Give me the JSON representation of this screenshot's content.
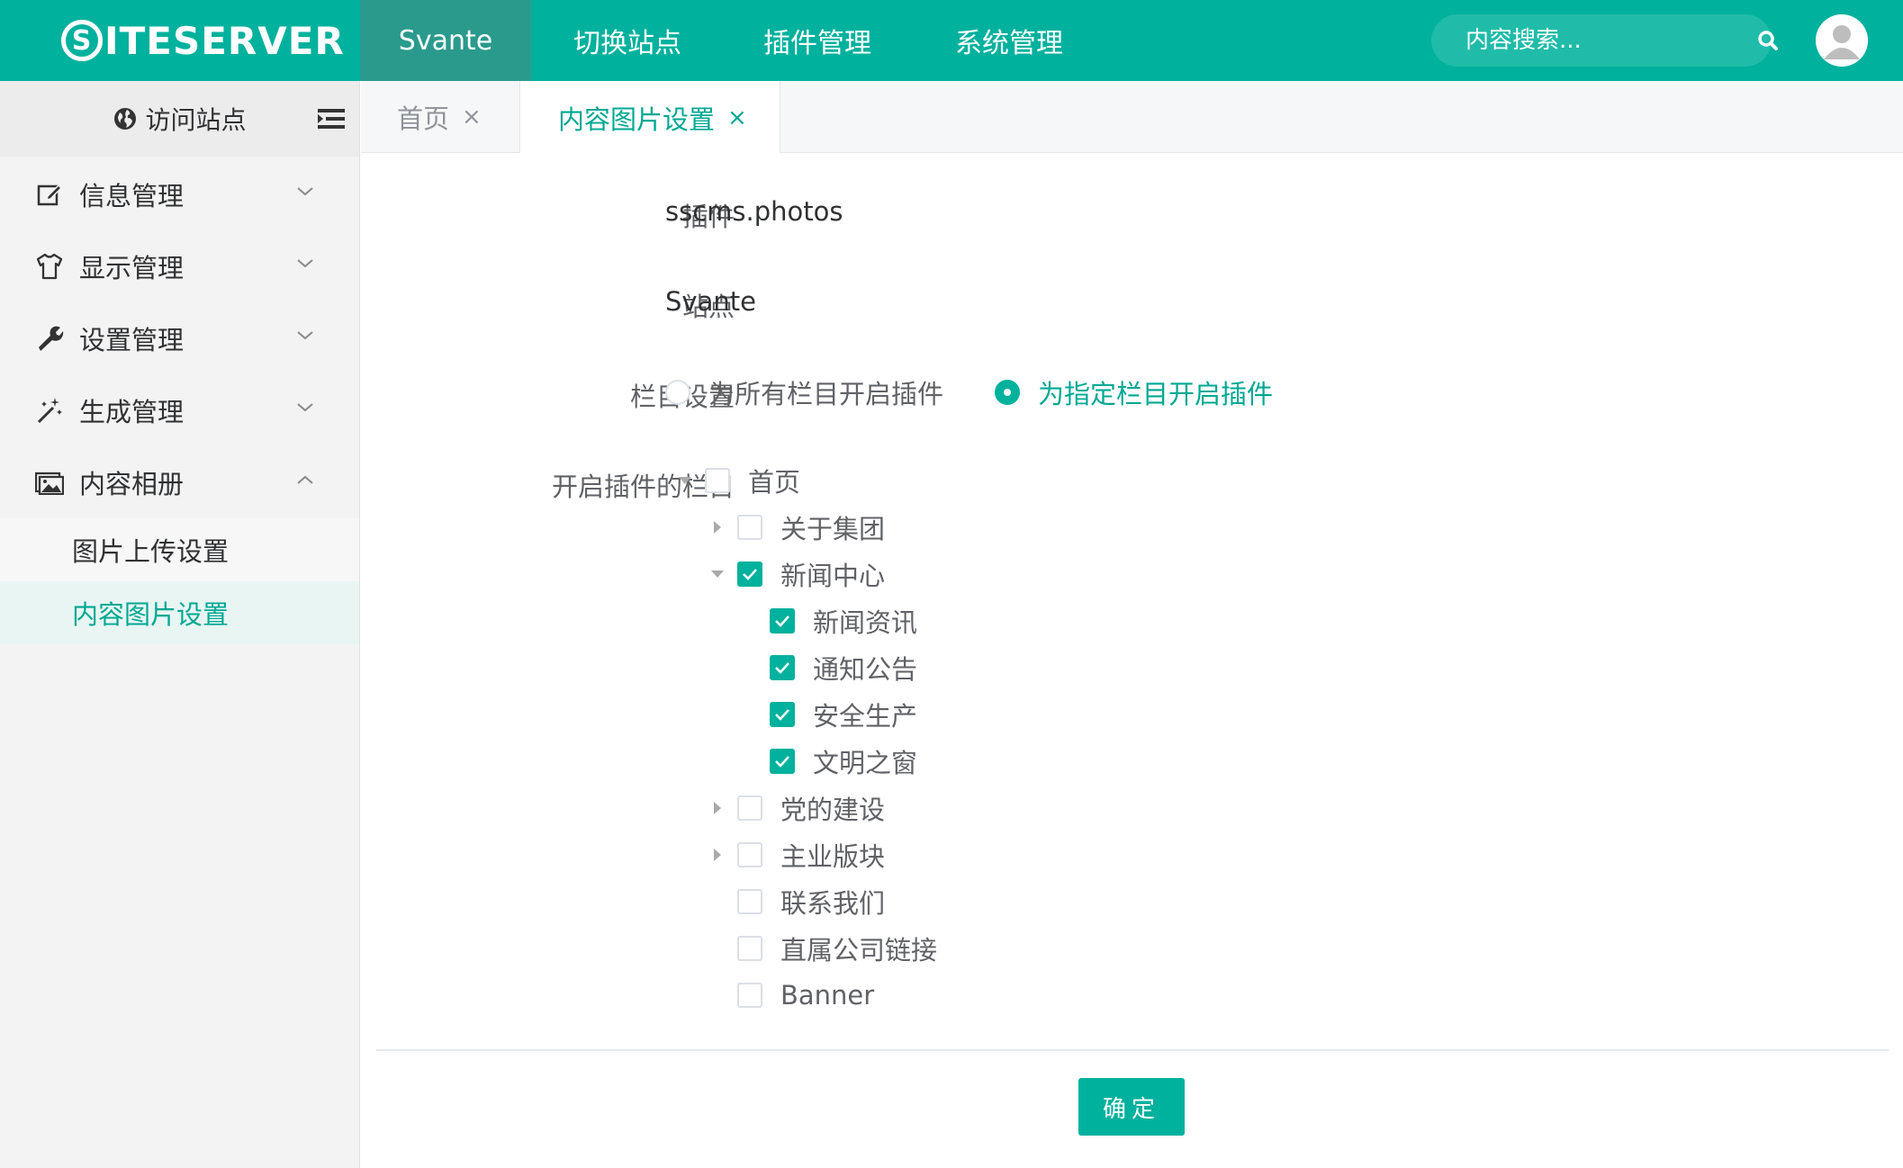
{
  "brand": {
    "logo_s": "S",
    "logo_rest": "ITESERVER"
  },
  "nav": {
    "items": [
      "Svante",
      "切换站点",
      "插件管理",
      "系统管理"
    ],
    "active": "Svante"
  },
  "search": {
    "placeholder": "内容搜索..."
  },
  "sidebar": {
    "visit_label": "访问站点",
    "items": [
      {
        "label": "信息管理",
        "icon": "edit-icon",
        "expanded": false
      },
      {
        "label": "显示管理",
        "icon": "shirt-icon",
        "expanded": false
      },
      {
        "label": "设置管理",
        "icon": "wrench-icon",
        "expanded": false
      },
      {
        "label": "生成管理",
        "icon": "magic-wand-icon",
        "expanded": false
      },
      {
        "label": "内容相册",
        "icon": "photo-album-icon",
        "expanded": true
      }
    ],
    "sub_items": [
      {
        "label": "图片上传设置",
        "active": false
      },
      {
        "label": "内容图片设置",
        "active": true
      }
    ]
  },
  "tabs": [
    {
      "label": "首页",
      "close": "×",
      "active": false
    },
    {
      "label": "内容图片设置",
      "close": "×",
      "active": true
    }
  ],
  "form": {
    "plugin_label": "插件",
    "plugin_value": "sscms.photos",
    "site_label": "站点",
    "site_value": "Svante",
    "column_setting_label": "栏目设置",
    "radio_all": "为所有栏目开启插件",
    "radio_specific": "为指定栏目开启插件",
    "selected_radio": "specific",
    "enabled_columns_label": "开启插件的栏目",
    "tree": [
      {
        "label": "首页",
        "level": 0,
        "caret": "expanded",
        "checked": false
      },
      {
        "label": "关于集团",
        "level": 1,
        "caret": "collapsed",
        "checked": false
      },
      {
        "label": "新闻中心",
        "level": 1,
        "caret": "expanded",
        "checked": true
      },
      {
        "label": "新闻资讯",
        "level": 2,
        "caret": "none",
        "checked": true
      },
      {
        "label": "通知公告",
        "level": 2,
        "caret": "none",
        "checked": true
      },
      {
        "label": "安全生产",
        "level": 2,
        "caret": "none",
        "checked": true
      },
      {
        "label": "文明之窗",
        "level": 2,
        "caret": "none",
        "checked": true
      },
      {
        "label": "党的建设",
        "level": 1,
        "caret": "collapsed",
        "checked": false
      },
      {
        "label": "主业版块",
        "level": 1,
        "caret": "collapsed",
        "checked": false
      },
      {
        "label": "联系我们",
        "level": 1,
        "caret": "none",
        "checked": false
      },
      {
        "label": "直属公司链接",
        "level": 1,
        "caret": "none",
        "checked": false
      },
      {
        "label": "Banner",
        "level": 1,
        "caret": "none",
        "checked": false
      }
    ],
    "submit_label": "确定"
  },
  "colors": {
    "primary": "#00b19d",
    "primary_text": "#00a893",
    "active_nav": "#2a9a8d"
  }
}
